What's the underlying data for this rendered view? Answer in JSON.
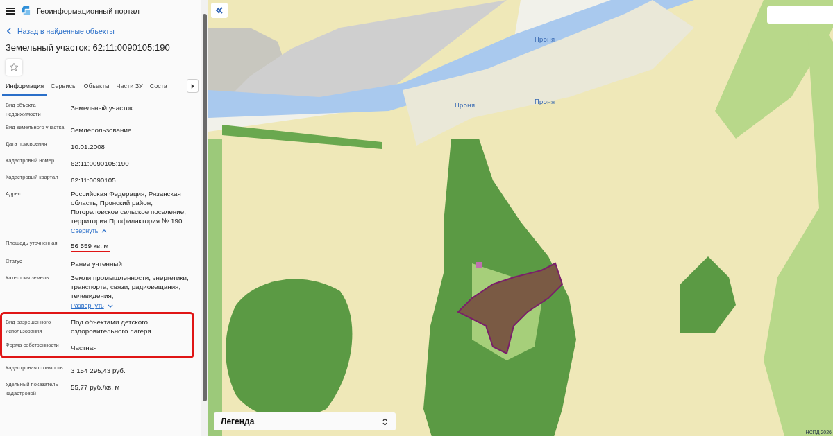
{
  "header": {
    "title": "Геоинформационный портал"
  },
  "back_link": "Назад в найденные объекты",
  "title": "Земельный участок: 62:11:0090105:190",
  "favorite": {
    "on": false
  },
  "tabs": [
    {
      "label": "Информация",
      "selected": true
    },
    {
      "label": "Сервисы",
      "selected": false
    },
    {
      "label": "Объекты",
      "selected": false
    },
    {
      "label": "Части ЗУ",
      "selected": false
    },
    {
      "label": "Соста",
      "selected": false
    }
  ],
  "groups": [
    {
      "highlighted": false,
      "rows": [
        {
          "label": "Вид объекта недвижимости",
          "value": "Земельный участок",
          "underlined": false
        },
        {
          "label": "Вид земельного участка",
          "value": "Землепользование",
          "underlined": false
        },
        {
          "label": "Дата присвоения",
          "value": "10.01.2008",
          "underlined": false
        },
        {
          "label": "Кадастровый номер",
          "value": "62:11:0090105:190",
          "underlined": false
        },
        {
          "label": "Кадастровый квартал",
          "value": "62:11:0090105",
          "underlined": false
        },
        {
          "label": "Адрес",
          "value": "Российская Федерация, Рязанская область, Пронский район, Погореловское сельское поселение, территория Профилактория № 190",
          "underlined": false,
          "toggle": {
            "text": "Свернуть",
            "expanded": true
          }
        },
        {
          "label": "Площадь уточненная",
          "value": "56 559 кв. м",
          "underlined": true
        },
        {
          "label": "Статус",
          "value": "Ранее учтенный",
          "underlined": false
        },
        {
          "label": "Категория земель",
          "value": "Земли промышленности, энергетики, транспорта, связи, радиовещания, телевидения,",
          "underlined": false,
          "toggle": {
            "text": "Развернуть",
            "expanded": false
          }
        }
      ]
    },
    {
      "highlighted": true,
      "rows": [
        {
          "label": "Вид разрешенного использования",
          "value": "Под объектами детского оздоровительного лагеря",
          "underlined": false
        },
        {
          "label": "Форма собственности",
          "value": "Частная",
          "underlined": false
        }
      ]
    },
    {
      "highlighted": false,
      "rows": [
        {
          "label": "Кадастровая стоимость",
          "value": "3 154 295,43 руб.",
          "underlined": false
        },
        {
          "label": "Удельный показатель кадастровой",
          "value": "55,77 руб./кв. м",
          "underlined": false
        }
      ]
    }
  ],
  "map": {
    "river_labels": [
      "Проня",
      "Проня",
      "Проня"
    ],
    "legend": "Легенда",
    "attribution": "НСПД 2026"
  }
}
